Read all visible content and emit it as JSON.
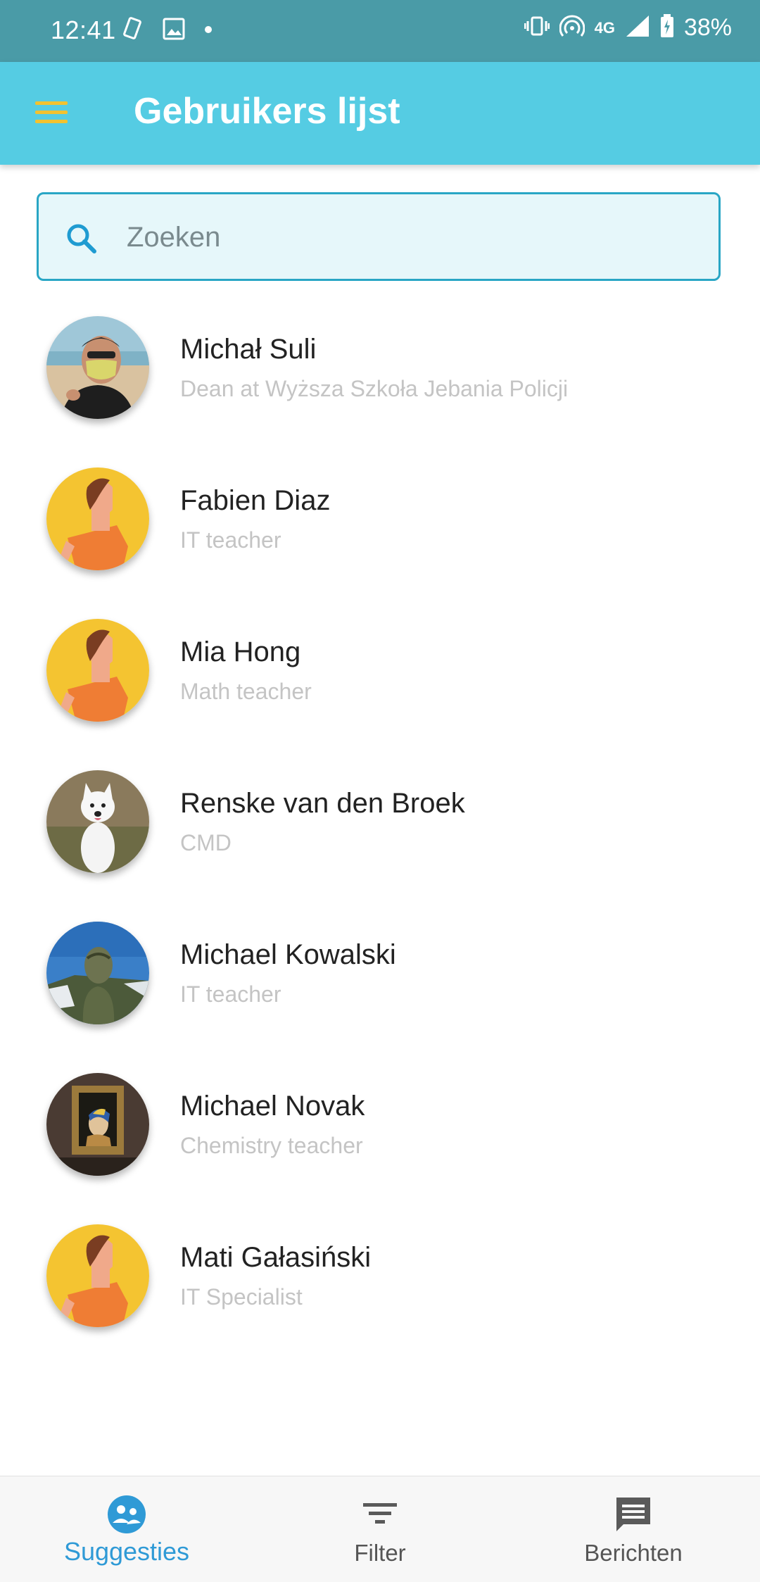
{
  "status_bar": {
    "time": "12:41",
    "network": "4G",
    "battery": "38%"
  },
  "app_bar": {
    "title": "Gebruikers lijst"
  },
  "search": {
    "placeholder": "Zoeken",
    "value": ""
  },
  "users": [
    {
      "name": "Michał Suli",
      "role": "Dean at Wyższa Szkoła Jebania Policji",
      "avatar": "photo-man-mask"
    },
    {
      "name": "Fabien Diaz",
      "role": "IT teacher",
      "avatar": "default-avatar"
    },
    {
      "name": "Mia Hong",
      "role": "Math teacher",
      "avatar": "default-avatar"
    },
    {
      "name": "Renske van den Broek",
      "role": "CMD",
      "avatar": "photo-dog"
    },
    {
      "name": "Michael Kowalski",
      "role": "IT teacher",
      "avatar": "photo-soldier"
    },
    {
      "name": "Michael Novak",
      "role": "Chemistry teacher",
      "avatar": "photo-painting"
    },
    {
      "name": "Mati Gałasiński",
      "role": "IT Specialist",
      "avatar": "default-avatar"
    }
  ],
  "bottom_nav": {
    "items": [
      {
        "label": "Suggesties",
        "icon": "people-circle-icon",
        "active": true
      },
      {
        "label": "Filter",
        "icon": "filter-icon",
        "active": false
      },
      {
        "label": "Berichten",
        "icon": "message-icon",
        "active": false
      }
    ]
  },
  "colors": {
    "status_bar": "#4a9ba7",
    "app_bar": "#55cce3",
    "menu_icon": "#f2c230",
    "search_border": "#29a6c5",
    "active_nav": "#2f9ad6"
  }
}
